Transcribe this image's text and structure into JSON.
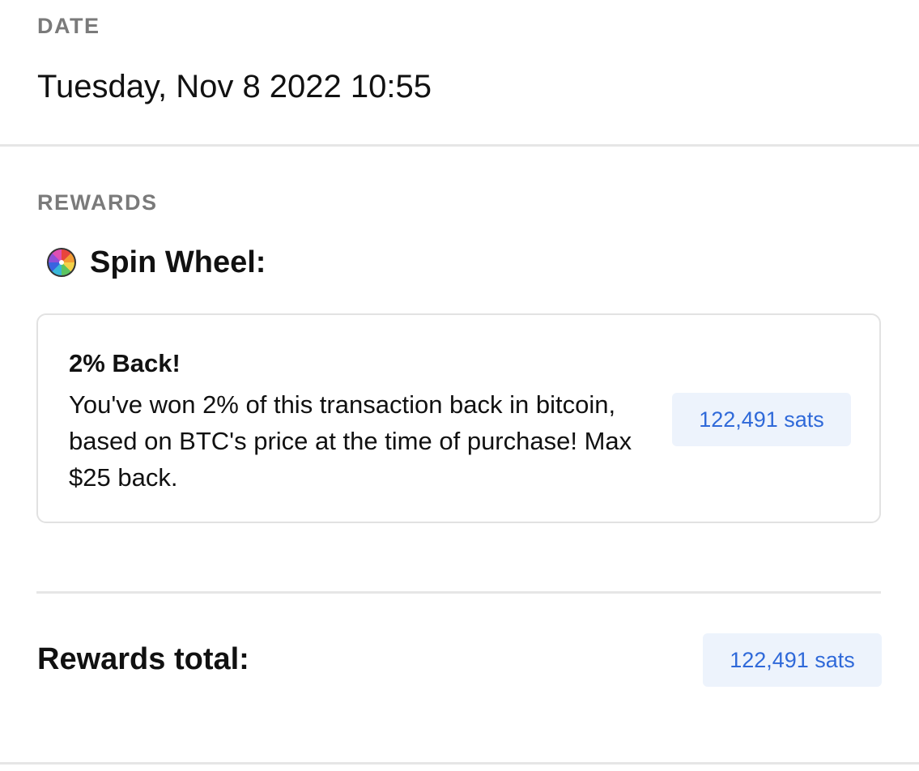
{
  "date": {
    "label": "DATE",
    "value": "Tuesday, Nov 8 2022 10:55"
  },
  "rewards": {
    "label": "REWARDS",
    "spin_wheel": {
      "icon": "spin-wheel-icon",
      "title": "Spin Wheel:"
    },
    "card": {
      "title": "2% Back!",
      "description": "You've won 2% of this transaction back in bitcoin, based on BTC's price at the time of purchase! Max $25 back.",
      "amount": "122,491 sats"
    },
    "total": {
      "label": "Rewards total:",
      "amount": "122,491 sats"
    }
  },
  "colors": {
    "accent": "#2f69d9",
    "badge_background": "#edf3fc",
    "section_label": "#7a7a7a",
    "divider": "#e6e6e6"
  }
}
